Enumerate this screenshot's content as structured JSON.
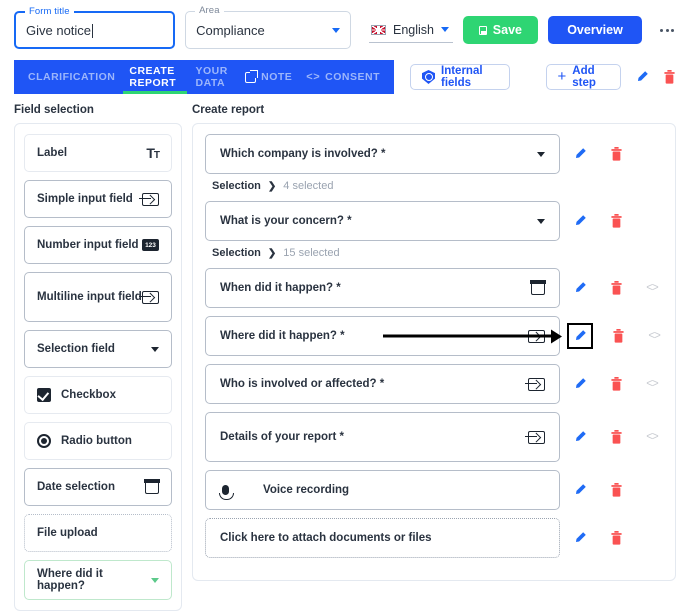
{
  "topbar": {
    "form_title": {
      "legend": "Form title",
      "value": "Give notice"
    },
    "area": {
      "legend": "Area",
      "value": "Compliance"
    },
    "language": {
      "label": "English",
      "flag": "uk-flag-icon"
    },
    "save_label": "Save",
    "overview_label": "Overview",
    "more_label": "kebab-menu-icon",
    "colors": {
      "save_green": "#2ed573",
      "primary_blue": "#1f55f5",
      "edit_blue": "#1f6bf5",
      "delete_red": "#fa5252"
    }
  },
  "tabs": [
    {
      "label": "CLARIFICATION",
      "active": false
    },
    {
      "label": "CREATE REPORT",
      "active": true
    },
    {
      "label": "YOUR DATA",
      "active": false
    },
    {
      "label": "NOTE",
      "active": false,
      "icon": "external-link-icon"
    },
    {
      "label": "CONSENT",
      "active": false,
      "icon": "code-icon"
    }
  ],
  "toolbar": {
    "internal_fields_label": "Internal fields",
    "add_step_label": "Add step",
    "add_step_plus": "+",
    "edit_icon": "pencil-icon",
    "delete_icon": "trash-icon"
  },
  "left": {
    "title": "Field selection",
    "items": [
      {
        "label": "Label",
        "icon": "text-format-icon",
        "style": "soft"
      },
      {
        "label": "Simple input field",
        "icon": "input-field-icon",
        "style": "normal"
      },
      {
        "label": "Number input field",
        "icon": "number-input-icon",
        "style": "normal"
      },
      {
        "label": "Multiline input field",
        "icon": "input-field-icon",
        "style": "tall"
      },
      {
        "label": "Selection field",
        "icon": "chevron-down-icon",
        "style": "normal"
      },
      {
        "label": "Checkbox",
        "icon": "checkbox-icon",
        "style": "soft-lead"
      },
      {
        "label": "Radio button",
        "icon": "radio-button-icon",
        "style": "soft-lead"
      },
      {
        "label": "Date selection",
        "icon": "calendar-icon",
        "style": "normal"
      },
      {
        "label": "File upload",
        "icon": "",
        "style": "dashed"
      },
      {
        "label": "Where did it happen?",
        "icon": "chevron-down-icon",
        "style": "greenbox"
      }
    ]
  },
  "right": {
    "title": "Create report",
    "rows": [
      {
        "kind": "field",
        "label": "Which company is involved? *",
        "icon": "chevron-down-icon",
        "actions": [
          "pencil-icon",
          "trash-icon"
        ],
        "tall": false,
        "highlighted": false
      },
      {
        "kind": "sub",
        "key": "Selection",
        "arrow": "❯",
        "value": "4 selected"
      },
      {
        "kind": "field",
        "label": "What is your concern? *",
        "icon": "chevron-down-icon",
        "actions": [
          "pencil-icon",
          "trash-icon"
        ],
        "tall": false,
        "highlighted": false
      },
      {
        "kind": "sub",
        "key": "Selection",
        "arrow": "❯",
        "value": "15 selected"
      },
      {
        "kind": "field",
        "label": "When did it happen? *",
        "icon": "calendar-icon",
        "actions": [
          "pencil-icon",
          "trash-icon",
          "code-icon"
        ],
        "tall": false,
        "highlighted": false
      },
      {
        "kind": "field",
        "label": "Where did it happen? *",
        "icon": "input-field-icon",
        "actions": [
          "pencil-icon",
          "trash-icon",
          "code-icon"
        ],
        "tall": false,
        "highlighted": true
      },
      {
        "kind": "field",
        "label": "Who is involved or affected? *",
        "icon": "input-field-icon",
        "actions": [
          "pencil-icon",
          "trash-icon",
          "code-icon"
        ],
        "tall": false,
        "highlighted": false
      },
      {
        "kind": "field",
        "label": "Details of your report *",
        "icon": "input-field-icon",
        "actions": [
          "pencil-icon",
          "trash-icon",
          "code-icon"
        ],
        "tall": true,
        "highlighted": false
      },
      {
        "kind": "voice",
        "label": "Voice recording",
        "icon": "microphone-icon",
        "actions": [
          "pencil-icon",
          "trash-icon"
        ]
      },
      {
        "kind": "upload",
        "label": "Click here to attach documents or files",
        "actions": [
          "pencil-icon",
          "trash-icon"
        ]
      }
    ]
  }
}
